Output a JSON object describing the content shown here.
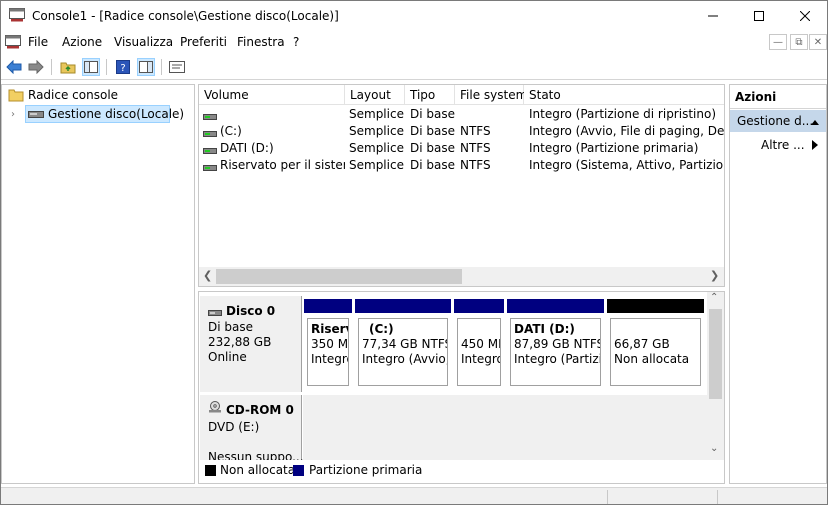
{
  "window": {
    "title": "Console1 - [Radice console\\Gestione disco(Locale)]"
  },
  "menu": [
    "File",
    "Azione",
    "Visualizza",
    "Preferiti",
    "Finestra",
    "?"
  ],
  "tree": {
    "root": "Radice console",
    "child": "Gestione disco(Locale)"
  },
  "volumes": {
    "columns": [
      "Volume",
      "Layout",
      "Tipo",
      "File system",
      "Stato"
    ],
    "rows": [
      {
        "volume": "",
        "layout": "Semplice",
        "tipo": "Di base",
        "fs": "",
        "stato": "Integro (Partizione di ripristino)"
      },
      {
        "volume": "(C:)",
        "layout": "Semplice",
        "tipo": "Di base",
        "fs": "NTFS",
        "stato": "Integro (Avvio, File di paging, Dettag"
      },
      {
        "volume": "DATI (D:)",
        "layout": "Semplice",
        "tipo": "Di base",
        "fs": "NTFS",
        "stato": "Integro (Partizione primaria)"
      },
      {
        "volume": "Riservato per il sistema",
        "layout": "Semplice",
        "tipo": "Di base",
        "fs": "NTFS",
        "stato": "Integro (Sistema, Attivo, Partizione pr"
      }
    ]
  },
  "disks": [
    {
      "name": "Disco 0",
      "type": "Di base",
      "size": "232,88 GB",
      "status": "Online",
      "partitions": [
        {
          "title": "Riserv",
          "size": "350 ME",
          "status": "Integro",
          "kind": "primary"
        },
        {
          "title": "(C:)",
          "size": "77,34 GB NTFS",
          "status": "Integro (Avvio,",
          "kind": "primary"
        },
        {
          "title": "",
          "size": "450 ME",
          "status": "Integro",
          "kind": "primary"
        },
        {
          "title": "DATI  (D:)",
          "size": "87,89 GB NTFS",
          "status": "Integro (Partizio",
          "kind": "primary"
        },
        {
          "title": "",
          "size": "66,87 GB",
          "status": "Non allocata",
          "kind": "unallocated"
        }
      ]
    },
    {
      "name": "CD-ROM 0",
      "type": "DVD (E:)",
      "status": "Nessun suppo..."
    }
  ],
  "legend": [
    {
      "label": "Non allocata",
      "color": "#000000"
    },
    {
      "label": "Partizione primaria",
      "color": "#000080"
    }
  ],
  "actions": {
    "header": "Azioni",
    "section": "Gestione d...",
    "more": "Altre ..."
  },
  "colors": {
    "primary": "#000080",
    "unallocated": "#000000",
    "selection": "#cce8ff",
    "actions_section": "#c5d7ea"
  }
}
